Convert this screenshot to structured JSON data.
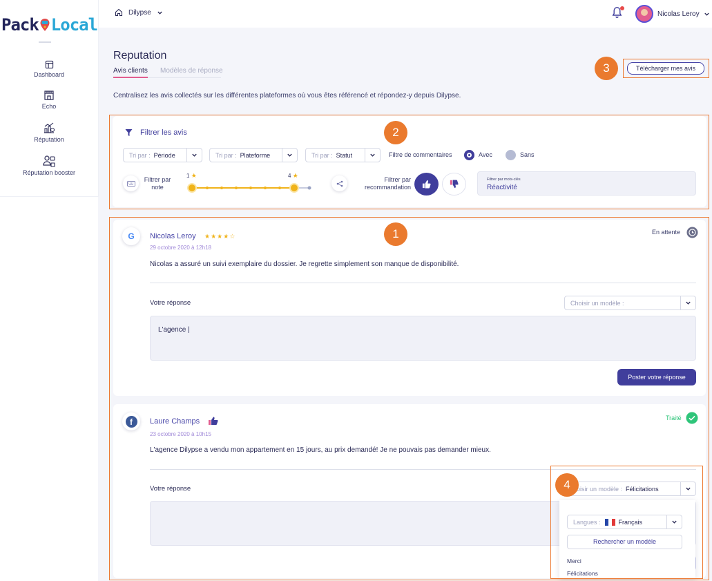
{
  "logo": {
    "part1": "Pack",
    "part2": "Local"
  },
  "sidebar": {
    "items": [
      {
        "label": "Dashboard",
        "icon": "layout-icon"
      },
      {
        "label": "Echo",
        "icon": "store-icon"
      },
      {
        "label": "Réputation",
        "icon": "chart-icon"
      },
      {
        "label": "Réputation booster",
        "icon": "booster-icon"
      }
    ]
  },
  "topbar": {
    "breadcrumb": "Dilypse",
    "user_name": "Nicolas Leroy"
  },
  "page": {
    "title": "Reputation",
    "tabs": [
      {
        "label": "Avis clients"
      },
      {
        "label": "Modèles de réponse"
      }
    ],
    "intro": "Centralisez les avis collectés sur les différentes plateformes où vous êtes référencé et répondez-y depuis Dilypse.",
    "download_label": "Télécharger mes avis"
  },
  "badges": [
    "1",
    "2",
    "3",
    "4"
  ],
  "filters": {
    "title": "Filtrer les avis",
    "selects": [
      {
        "label": "Tri par :",
        "value": "Période"
      },
      {
        "label": "Tri par :",
        "value": "Plateforme"
      },
      {
        "label": "Tri par :",
        "value": "Statut"
      }
    ],
    "comment_filter_label": "Filtre de commentaires",
    "option_with": "Avec",
    "option_without": "Sans",
    "note_label_line1": "Filtrer par",
    "note_label_line2": "note",
    "slider_min": "1",
    "slider_max": "4",
    "reco_label_line1": "Filtrer par",
    "reco_label_line2": "recommandation",
    "keyword_label": "Filtrer par mots-clés",
    "keyword_value": "Réactivité"
  },
  "reviews": [
    {
      "name": "Nicolas Leroy",
      "platform": "google",
      "platform_glyph": "G",
      "rating": 4,
      "date": "29 octobre 2020 à 12h18",
      "text": "Nicolas a assuré un suivi exemplaire du dossier. Je regrette simplement son manque de disponibilité.",
      "status": "En attente",
      "reply_label": "Votre réponse",
      "template_placeholder": "Choisir un modèle :",
      "reply_text": "L'agence |",
      "post_label": "Poster votre réponse"
    },
    {
      "name": "Laure Champs",
      "platform": "facebook",
      "platform_glyph": "f",
      "recommendation": "positive",
      "date": "23 octobre 2020 à 10h15",
      "text": "L'agence Dilypse a vendu mon appartement en 15 jours, au prix demandé! Je ne pouvais pas demander mieux.",
      "status": "Traité",
      "reply_label": "Votre réponse",
      "template_label": "hoisir un modèle :",
      "template_value": "Félicitations"
    }
  ],
  "template_dropdown": {
    "lang_label": "Langues :",
    "lang_value": "Français",
    "search_label": "Rechercher un modèle",
    "options": [
      "Merci",
      "Félicitations"
    ]
  },
  "colors": {
    "primary": "#403e9c",
    "accent": "#e25d8f",
    "highlight": "#ec7a33",
    "star": "#f0b31a",
    "success": "#2fc57a"
  }
}
